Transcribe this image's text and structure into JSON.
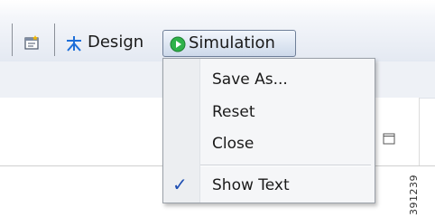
{
  "toolbar": {
    "design_label": "Design",
    "simulation_label": "Simulation",
    "simulation_active": true
  },
  "menu": {
    "items": [
      {
        "label": "Save As...",
        "checked": false
      },
      {
        "label": "Reset",
        "checked": false
      },
      {
        "label": "Close",
        "checked": false
      },
      {
        "label": "Show Text",
        "checked": true
      }
    ]
  },
  "figure_id": "391239",
  "colors": {
    "accent": "#2fb24a",
    "check": "#1f4fb3",
    "design_icon": "#1e6fd9"
  },
  "icons": {
    "properties": "window-properties-icon",
    "design": "network-nodes-icon",
    "simulation": "play-circle-icon",
    "maximize": "maximize-icon",
    "check": "check-icon"
  }
}
